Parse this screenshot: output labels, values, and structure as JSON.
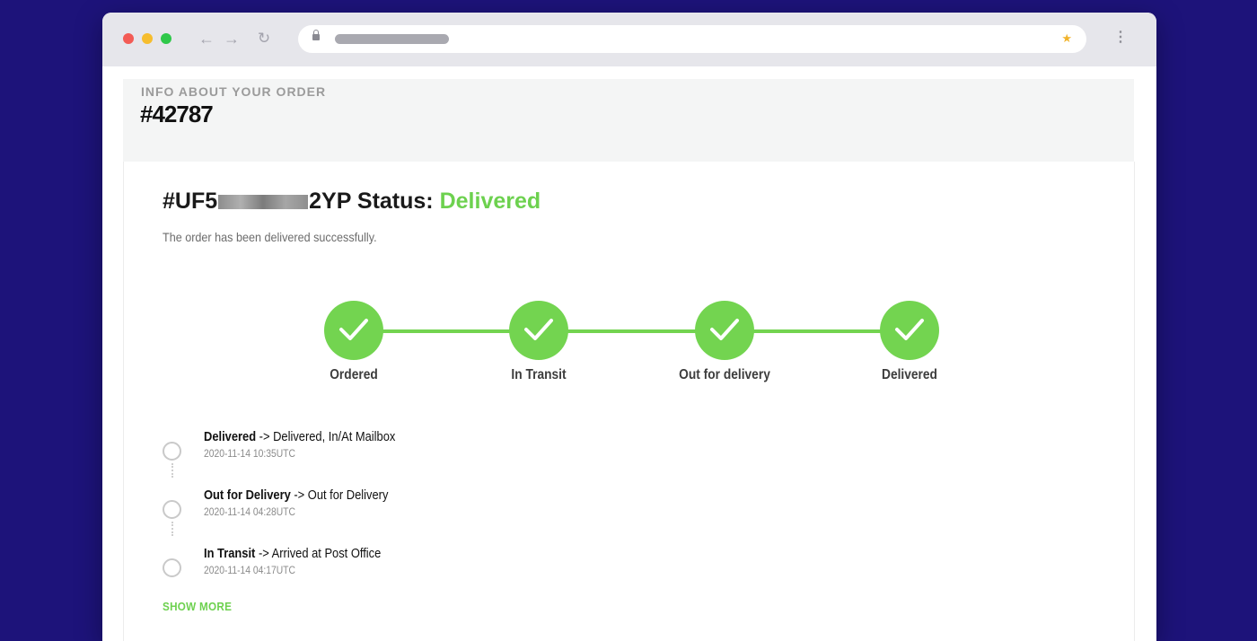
{
  "browser": {
    "nav": {
      "back": "←",
      "forward": "→",
      "reload": "↻"
    },
    "star_icon": "★",
    "menu_icon": "⋮"
  },
  "order": {
    "eyebrow": "INFO ABOUT YOUR ORDER",
    "number": "#42787"
  },
  "shipment": {
    "id_prefix": "#UF5",
    "id_suffix": "2YP",
    "status_label": "Status:",
    "status_value": "Delivered",
    "description": "The order has been delivered successfully."
  },
  "steps": [
    {
      "label": "Ordered",
      "completed": true
    },
    {
      "label": "In Transit",
      "completed": true
    },
    {
      "label": "Out for delivery",
      "completed": true
    },
    {
      "label": "Delivered",
      "completed": true
    }
  ],
  "events": [
    {
      "status": "Delivered",
      "arrow": "->",
      "detail": "Delivered, In/At Mailbox",
      "time": "2020-11-14 10:35UTC"
    },
    {
      "status": "Out for Delivery",
      "arrow": "->",
      "detail": "Out for Delivery",
      "time": "2020-11-14 04:28UTC"
    },
    {
      "status": "In Transit",
      "arrow": "->",
      "detail": "Arrived at Post Office",
      "time": "2020-11-14 04:17UTC"
    }
  ],
  "show_more": "SHOW MORE",
  "colors": {
    "accent": "#73d450",
    "background": "#1d137a"
  }
}
